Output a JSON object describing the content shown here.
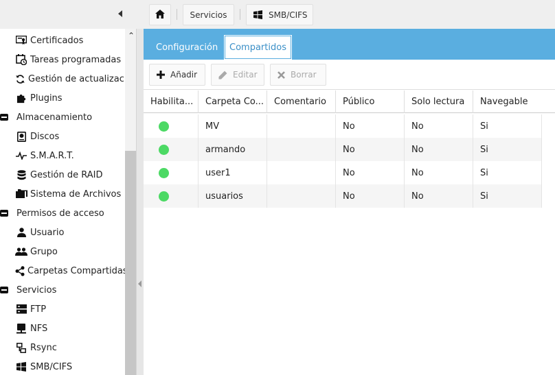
{
  "breadcrumb": {
    "home_icon": "home-icon",
    "services": "Servicios",
    "current": "SMB/CIFS"
  },
  "sidebar": {
    "items": [
      {
        "label": "Certificados",
        "icon": "certificate-icon",
        "type": "child"
      },
      {
        "label": "Tareas programadas",
        "icon": "scheduled-task-icon",
        "type": "child"
      },
      {
        "label": "Gestión de actualizaciones",
        "icon": "update-icon",
        "type": "child"
      },
      {
        "label": "Plugins",
        "icon": "puzzle-icon",
        "type": "child"
      },
      {
        "label": "Almacenamiento",
        "icon": "collapse-icon",
        "type": "group"
      },
      {
        "label": "Discos",
        "icon": "disk-icon",
        "type": "child"
      },
      {
        "label": "S.M.A.R.T.",
        "icon": "pulse-icon",
        "type": "child"
      },
      {
        "label": "Gestión de RAID",
        "icon": "database-icon",
        "type": "child"
      },
      {
        "label": "Sistema de Archivos",
        "icon": "folder-icon",
        "type": "child"
      },
      {
        "label": "Permisos de acceso",
        "icon": "collapse-icon",
        "type": "group"
      },
      {
        "label": "Usuario",
        "icon": "user-icon",
        "type": "child"
      },
      {
        "label": "Grupo",
        "icon": "group-icon",
        "type": "child"
      },
      {
        "label": "Carpetas Compartidas",
        "icon": "share-icon",
        "type": "child"
      },
      {
        "label": "Servicios",
        "icon": "collapse-icon",
        "type": "group"
      },
      {
        "label": "FTP",
        "icon": "server-icon",
        "type": "child"
      },
      {
        "label": "NFS",
        "icon": "nfs-icon",
        "type": "child"
      },
      {
        "label": "Rsync",
        "icon": "rsync-icon",
        "type": "child"
      },
      {
        "label": "SMB/CIFS",
        "icon": "windows-icon",
        "type": "child"
      }
    ]
  },
  "tabs": {
    "config": "Configuración",
    "shares": "Compartidos",
    "active": "Compartidos"
  },
  "toolbar": {
    "add": "Añadir",
    "edit": "Editar",
    "delete": "Borrar"
  },
  "table": {
    "columns": [
      "Habilita...",
      "Carpeta Co...",
      "Comentario",
      "Público",
      "Solo lectura",
      "Navegable"
    ],
    "rows": [
      {
        "enabled": true,
        "folder": "MV",
        "comment": "",
        "public": "No",
        "readonly": "No",
        "browsable": "Si"
      },
      {
        "enabled": true,
        "folder": "armando",
        "comment": "",
        "public": "No",
        "readonly": "No",
        "browsable": "Si"
      },
      {
        "enabled": true,
        "folder": "user1",
        "comment": "",
        "public": "No",
        "readonly": "No",
        "browsable": "Si"
      },
      {
        "enabled": true,
        "folder": "usuarios",
        "comment": "",
        "public": "No",
        "readonly": "No",
        "browsable": "Si"
      }
    ]
  },
  "colors": {
    "accent": "#5aaee0",
    "enabled_dot": "#4cd964"
  }
}
